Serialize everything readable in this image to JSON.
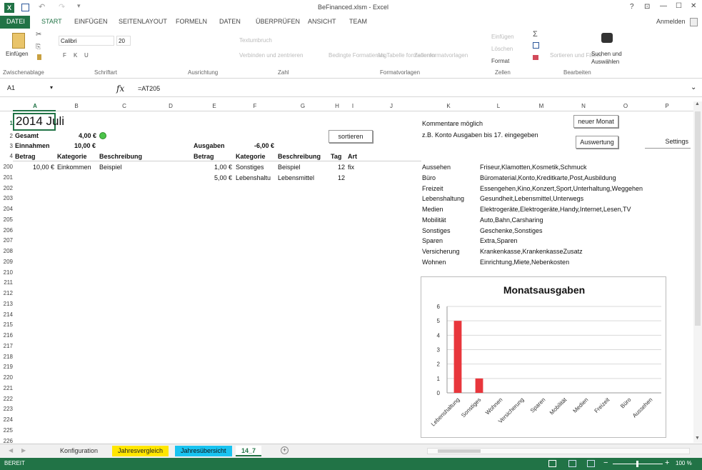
{
  "title": "BeFinanced.xlsm - Excel",
  "window_controls": [
    "?",
    "⊡",
    "—",
    "☐",
    "✕"
  ],
  "tabs": [
    "DATEI",
    "START",
    "EINFÜGEN",
    "SEITENLAYOUT",
    "FORMELN",
    "DATEN",
    "ÜBERPRÜFEN",
    "ANSICHT",
    "TEAM"
  ],
  "signin": "Anmelden",
  "ribbon": {
    "paste": "Einfügen",
    "font_name": "Calibri",
    "font_size": "20",
    "bold": "F",
    "italic": "K",
    "underline": "U",
    "wrap": "Textumbruch",
    "merge": "Verbinden und zentrieren",
    "cond_format": "Bedingte Formatierung",
    "as_table": "Als Tabelle formatieren",
    "cell_styles": "Zellenformatvorlagen",
    "insert": "Einfügen",
    "delete": "Löschen",
    "format": "Format",
    "sort_filter": "Sortieren und Filtern",
    "find_select_1": "Suchen und",
    "find_select_2": "Auswählen",
    "groups": [
      "Zwischenablage",
      "Schriftart",
      "Ausrichtung",
      "Zahl",
      "Formatvorlagen",
      "Zellen",
      "Bearbeiten"
    ]
  },
  "formula": {
    "namebox": "A1",
    "fx": "fx",
    "value": "=AT205"
  },
  "columns": [
    "A",
    "B",
    "C",
    "D",
    "E",
    "F",
    "G",
    "H",
    "I",
    "J",
    "K",
    "L",
    "M",
    "N",
    "O",
    "P"
  ],
  "row_numbers": [
    "1",
    "2",
    "3",
    "4",
    "200",
    "201",
    "202",
    "203",
    "204",
    "205",
    "206",
    "207",
    "208",
    "209",
    "210",
    "211",
    "212",
    "213",
    "214",
    "215",
    "216",
    "217",
    "218",
    "219",
    "220",
    "221",
    "222",
    "223",
    "224",
    "225",
    "226"
  ],
  "sheet": {
    "title": "2014 Juli",
    "gesamt_label": "Gesamt",
    "gesamt_value": "4,00 €",
    "einnahmen_label": "Einnahmen",
    "einnahmen_value": "10,00 €",
    "ausgaben_label": "Ausgaben",
    "ausgaben_value": "-6,00 €",
    "headers_left": [
      "Betrag",
      "Kategorie",
      "Beschreibung"
    ],
    "headers_right": [
      "Betrag",
      "Kategorie",
      "Beschreibung",
      "Tag",
      "Art"
    ],
    "income_rows": [
      {
        "betrag": "10,00 €",
        "kategorie": "Einkommen",
        "beschreibung": "Beispiel"
      }
    ],
    "expense_rows": [
      {
        "betrag": "1,00 €",
        "kategorie": "Sonstiges",
        "beschreibung": "Beispiel",
        "tag": "12",
        "art": "fix"
      },
      {
        "betrag": "5,00 €",
        "kategorie": "Lebenshaltu",
        "beschreibung": "Lebensmittel",
        "tag": "12",
        "art": ""
      }
    ],
    "sort_button": "sortieren",
    "comments_line1": "Kommentare möglich",
    "comments_line2": "z.B. Konto Ausgaben bis 17. eingegeben",
    "new_month_button": "neuer Monat",
    "eval_button": "Auswertung",
    "settings_button": "Settings",
    "categories": [
      {
        "name": "Aussehen",
        "items": "Friseur,Klamotten,Kosmetik,Schmuck"
      },
      {
        "name": "Büro",
        "items": "Büromaterial,Konto,Kreditkarte,Post,Ausbildung"
      },
      {
        "name": "Freizeit",
        "items": "Essengehen,Kino,Konzert,Sport,Unterhaltung,Weggehen"
      },
      {
        "name": "Lebenshaltung",
        "items": "Gesundheit,Lebensmittel,Unterwegs"
      },
      {
        "name": "Medien",
        "items": "Elektrogeräte,Elektrogeräte,Handy,Internet,Lesen,TV"
      },
      {
        "name": "Mobilität",
        "items": "Auto,Bahn,Carsharing"
      },
      {
        "name": "Sonstiges",
        "items": "Geschenke,Sonstiges"
      },
      {
        "name": "Sparen",
        "items": "Extra,Sparen"
      },
      {
        "name": "Versicherung",
        "items": "Krankenkasse,KrankenkasseZusatz"
      },
      {
        "name": "Wohnen",
        "items": "Einrichtung,Miete,Nebenkosten"
      }
    ]
  },
  "chart_data": {
    "type": "bar",
    "title": "Monatsausgaben",
    "categories": [
      "Lebenshaltung",
      "Sonstiges",
      "Wohnen",
      "Versicherung",
      "Sparen",
      "Mobilität",
      "Medien",
      "Freizeit",
      "Büro",
      "Aussehen"
    ],
    "values": [
      5,
      1,
      0,
      0,
      0,
      0,
      0,
      0,
      0,
      0
    ],
    "ylim": [
      0,
      6
    ],
    "yticks": [
      "0",
      "1",
      "2",
      "3",
      "4",
      "5",
      "6"
    ],
    "bar_color": "#e8363c",
    "grid": true
  },
  "sheet_tabs": [
    {
      "label": "Konfiguration",
      "color": "#f0f0f0"
    },
    {
      "label": "Jahresvergleich",
      "color": "#ffe600"
    },
    {
      "label": "Jahresübersicht",
      "color": "#19c3f0"
    },
    {
      "label": "14_7",
      "color": "#ffffff"
    }
  ],
  "status": {
    "ready": "BEREIT",
    "zoom": "100 %"
  },
  "colors": {
    "excel_green": "#217346"
  }
}
